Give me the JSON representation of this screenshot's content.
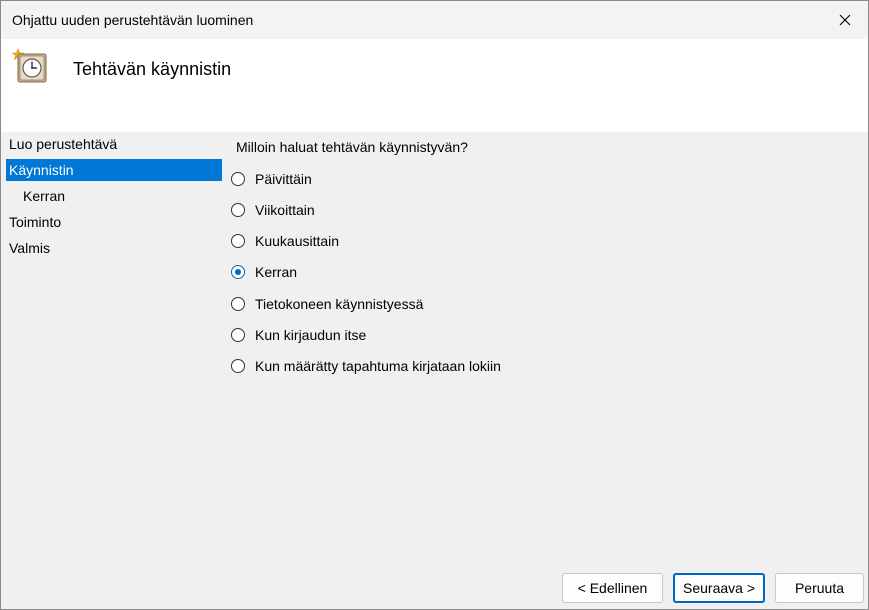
{
  "window": {
    "title": "Ohjattu uuden perustehtävän luominen"
  },
  "header": {
    "title": "Tehtävän käynnistin",
    "icon": "scheduled-task-clock-icon"
  },
  "steps": [
    {
      "label": "Luo perustehtävä"
    },
    {
      "label": "Käynnistin",
      "active": true
    },
    {
      "label": "Kerran",
      "sub": true
    },
    {
      "label": "Toiminto"
    },
    {
      "label": "Valmis"
    }
  ],
  "content": {
    "question": "Milloin haluat tehtävän käynnistyvän?",
    "options": [
      {
        "label": "Päivittäin",
        "checked": false
      },
      {
        "label": "Viikoittain",
        "checked": false
      },
      {
        "label": "Kuukausittain",
        "checked": false
      },
      {
        "label": "Kerran",
        "checked": true
      },
      {
        "label": "Tietokoneen käynnistyessä",
        "checked": false
      },
      {
        "label": "Kun kirjaudun itse",
        "checked": false
      },
      {
        "label": "Kun määrätty tapahtuma kirjataan lokiin",
        "checked": false
      }
    ]
  },
  "buttons": {
    "back": "< Edellinen",
    "next": "Seuraava >",
    "cancel": "Peruuta"
  },
  "colors": {
    "selection": "#0078d7",
    "radio_accent": "#0067c0",
    "default_button_border": "#0067c0"
  }
}
